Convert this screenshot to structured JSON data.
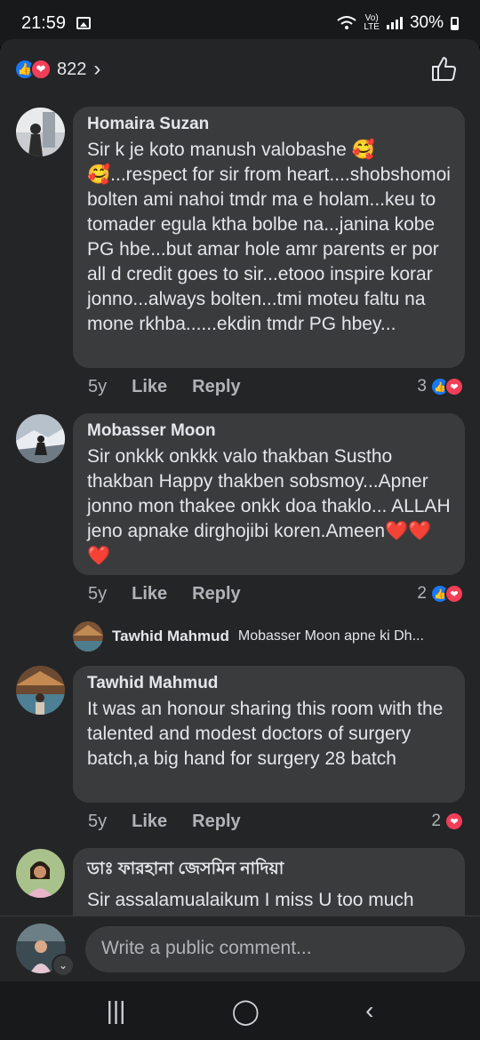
{
  "status": {
    "time": "21:59",
    "network_top": "Vo)",
    "network_bottom": "LTE",
    "battery": "30%"
  },
  "reactions": {
    "count": "822"
  },
  "comments": [
    {
      "name": "Homaira Suzan",
      "text": "Sir k je koto manush valobashe 🥰\n🥰...respect for sir from heart....shobshomoi bolten ami nahoi tmdr ma e holam...keu to tomader egula ktha bolbe na...janina kobe PG hbe...but amar hole amr parents er por all d credit goes to sir...etooo inspire korar jonno...always bolten...tmi moteu faltu na mone rkhba......ekdin tmdr PG hbey...",
      "time": "5y",
      "like": "Like",
      "reply": "Reply",
      "reaction_count": "3"
    },
    {
      "name": "Mobasser Moon",
      "text": "Sir onkkk onkkk valo thakban Sustho thakban Happy thakben sobsmoy...Apner jonno mon thakee onkk doa thaklo... ALLAH jeno apnake dirghojibi koren.Ameen❤️❤️❤️",
      "time": "5y",
      "like": "Like",
      "reply": "Reply",
      "reaction_count": "2"
    },
    {
      "name": "Tawhid Mahmud",
      "text": "It was an honour sharing this room with the talented and modest doctors of surgery batch,a big hand for surgery 28 batch",
      "time": "5y",
      "like": "Like",
      "reply": "Reply",
      "reaction_count": "2"
    },
    {
      "name": "ডাঃ ফারহানা জেসমিন নাদিয়া",
      "text": "Sir assalamualaikum I miss U too much"
    }
  ],
  "reply_preview": {
    "name": "Tawhid Mahmud",
    "text": "Mobasser Moon apne ki Dh..."
  },
  "composer": {
    "placeholder": "Write a public comment..."
  },
  "icons": {
    "like": "like-icon",
    "love": "love-icon",
    "thumbs_up": "thumbs-up-outline-icon"
  },
  "colors": {
    "like": "#1877f2",
    "love": "#f33e58",
    "bubble": "#3a3b3c",
    "background": "#242526"
  }
}
